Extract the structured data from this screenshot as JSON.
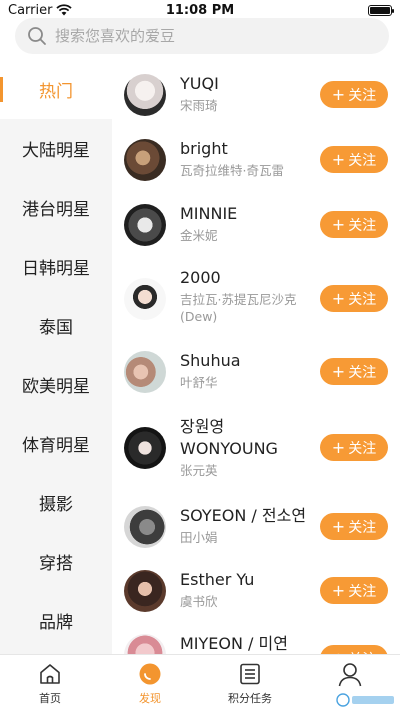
{
  "status": {
    "carrier": "Carrier",
    "time": "11:08 PM"
  },
  "search": {
    "placeholder": "搜索您喜欢的爱豆"
  },
  "sidebar": {
    "items": [
      {
        "label": "热门",
        "active": true
      },
      {
        "label": "大陆明星"
      },
      {
        "label": "港台明星"
      },
      {
        "label": "日韩明星"
      },
      {
        "label": "泰国"
      },
      {
        "label": "欧美明星"
      },
      {
        "label": "体育明星"
      },
      {
        "label": "摄影"
      },
      {
        "label": "穿搭"
      },
      {
        "label": "品牌"
      }
    ]
  },
  "idols": [
    {
      "name": "YUQI",
      "sub": "宋雨琦",
      "follow": "关注"
    },
    {
      "name": "bright",
      "sub": "瓦奇拉维特·奇瓦雷",
      "follow": "关注"
    },
    {
      "name": "MINNIE",
      "sub": "金米妮",
      "follow": "关注"
    },
    {
      "name": "2000",
      "sub": "吉拉瓦·苏提瓦尼沙克(Dew)",
      "follow": "关注"
    },
    {
      "name": "Shuhua",
      "sub": "叶舒华",
      "follow": "关注"
    },
    {
      "name": "장원영 WONYOUNG",
      "sub": "张元英",
      "follow": "关注"
    },
    {
      "name": "SOYEON / 전소연",
      "sub": "田小娟",
      "follow": "关注"
    },
    {
      "name": "Esther Yu",
      "sub": "虞书欣",
      "follow": "关注"
    },
    {
      "name": "MIYEON / 미연",
      "sub": "",
      "follow": "关注"
    }
  ],
  "tabbar": {
    "tabs": [
      {
        "label": "首页",
        "icon": "home-icon"
      },
      {
        "label": "发现",
        "icon": "discover-icon",
        "active": true
      },
      {
        "label": "积分任务",
        "icon": "task-list-icon"
      },
      {
        "label": "",
        "icon": "profile-icon"
      }
    ]
  },
  "colors": {
    "accent": "#f3952f",
    "button": "#f79a35",
    "sidebar_bg": "#f5f5f5"
  }
}
